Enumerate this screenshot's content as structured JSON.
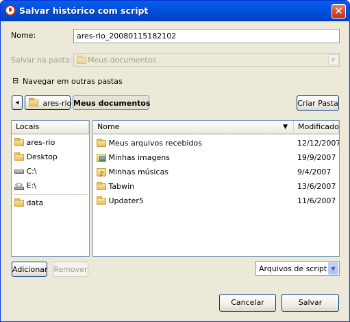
{
  "window": {
    "title": "Salvar histórico com script",
    "close_glyph": "✕"
  },
  "form": {
    "name_label": "Nome:",
    "name_value": "ares-rio_20080115182102",
    "folder_label": "Salvar na pasta:",
    "folder_value": "Meus documentos",
    "browse_label": "Navegar em outras pastas",
    "browse_expander": "⊟"
  },
  "path_bar": {
    "back_glyph": "◂",
    "segments": [
      "ares-rio",
      "Meus documentos"
    ],
    "create_folder_label": "Criar Pasta"
  },
  "places": {
    "header": "Locais",
    "items": [
      {
        "label": "ares-rio",
        "icon": "folder-icon"
      },
      {
        "label": "Desktop",
        "icon": "folder-icon"
      },
      {
        "label": "C:\\",
        "icon": "hard-drive-icon"
      },
      {
        "label": "E:\\",
        "icon": "cd-drive-icon"
      },
      {
        "label": "data",
        "icon": "folder-icon"
      }
    ],
    "add_label": "Adicionar",
    "remove_label": "Remover"
  },
  "files": {
    "columns": {
      "name": "Nome",
      "modified": "Modificado",
      "sort_glyph": "▼"
    },
    "rows": [
      {
        "name": "Meus arquivos recebidos",
        "modified": "12/12/2007",
        "icon": "folder-icon"
      },
      {
        "name": "Minhas imagens",
        "modified": "19/9/2007",
        "icon": "pictures-folder-icon"
      },
      {
        "name": "Minhas músicas",
        "modified": "9/4/2007",
        "icon": "music-folder-icon"
      },
      {
        "name": "Tabwin",
        "modified": "13/6/2007",
        "icon": "folder-icon"
      },
      {
        "name": "Updater5",
        "modified": "11/6/2007",
        "icon": "folder-icon"
      }
    ]
  },
  "filter": {
    "value": "Arquivos de script",
    "arrow_glyph": "▼"
  },
  "actions": {
    "cancel_label": "Cancelar",
    "save_label": "Salvar"
  }
}
